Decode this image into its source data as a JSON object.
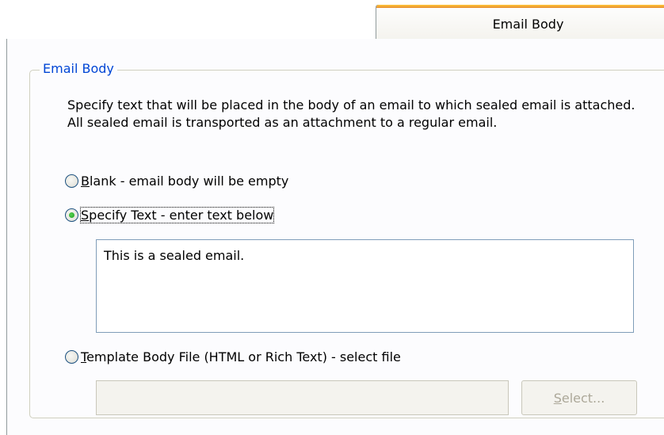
{
  "tab": {
    "label": "Email Body"
  },
  "group": {
    "legend": "Email Body",
    "description": "Specify text that will be placed in the body of an email to which sealed email is attached. All sealed email is transported as an attachment to a regular email."
  },
  "options": {
    "blank": {
      "accel": "B",
      "rest": "lank - email body will be empty",
      "checked": false
    },
    "specify": {
      "accel": "S",
      "rest": "pecify Text - enter text below",
      "checked": true
    },
    "template": {
      "accel": "T",
      "rest": "emplate Body File (HTML or Rich Text) - select file",
      "checked": false
    }
  },
  "body_text": "This is a sealed email.",
  "file_path": "",
  "select_button": {
    "accel": "S",
    "rest": "elect..."
  },
  "colors": {
    "tab_accent": "#e68b2c",
    "legend": "#0046d5",
    "radio_checked": "#21a121",
    "disabled_text": "#aca899"
  }
}
